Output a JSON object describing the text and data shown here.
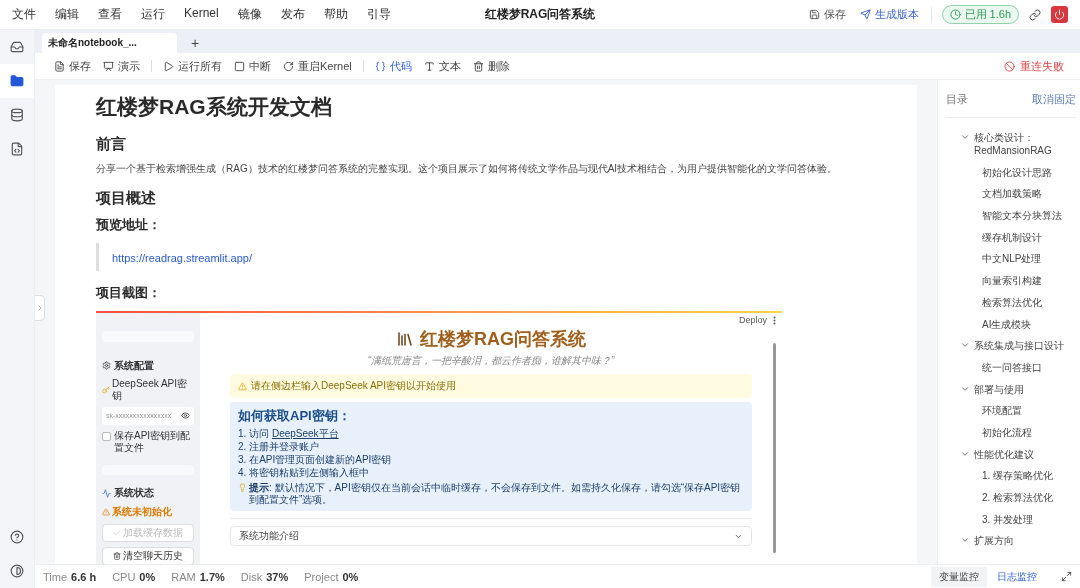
{
  "menu": [
    "文件",
    "编辑",
    "查看",
    "运行",
    "Kernel",
    "镜像",
    "发布",
    "帮助",
    "引导"
  ],
  "title": "红楼梦RAG问答系统",
  "header_actions": [
    {
      "label": "保存",
      "kind": "save"
    },
    {
      "label": "生成版本",
      "kind": "publish"
    }
  ],
  "usage": "已用 1.6h",
  "rail": [
    {
      "kind": "inbox",
      "selected": false
    },
    {
      "kind": "folder",
      "selected": true
    },
    {
      "kind": "database",
      "selected": false
    },
    {
      "kind": "code",
      "selected": false
    }
  ],
  "rail_bottom": [
    {
      "kind": "help"
    },
    {
      "kind": "theme"
    }
  ],
  "tabs": [
    {
      "label": "未命名notebook_...",
      "selected": true
    }
  ],
  "new_tab": "+",
  "toolbar": {
    "groups": [
      [
        {
          "label": "保存",
          "kind": "save",
          "selected": false
        },
        {
          "label": "演示",
          "kind": "present",
          "selected": false
        }
      ],
      [
        {
          "label": "运行所有",
          "kind": "run",
          "selected": false
        },
        {
          "label": "中断",
          "kind": "stop",
          "selected": false
        },
        {
          "label": "重启Kernel",
          "kind": "restart",
          "selected": false
        }
      ],
      [
        {
          "label": "代码",
          "kind": "code",
          "selected": true
        },
        {
          "label": "文本",
          "kind": "text",
          "selected": false
        },
        {
          "label": "删除",
          "kind": "delete",
          "selected": false
        }
      ]
    ]
  },
  "connection": "重连失败",
  "document": {
    "blocks": [
      {
        "kind": "h1",
        "text": "红楼梦RAG系统开发文档"
      },
      {
        "kind": "h2",
        "text": "前言"
      },
      {
        "kind": "p",
        "text": "分享一个基于检索增强生成（RAG）技术的红楼梦问答系统的完整实现。这个项目展示了如何将传统文学作品与现代AI技术相结合，为用户提供智能化的文学问答体验。"
      },
      {
        "kind": "h2",
        "text": "项目概述"
      },
      {
        "kind": "h3",
        "text": "预览地址："
      },
      {
        "kind": "quote_link",
        "text": "https://readrag.streamlit.app/"
      },
      {
        "kind": "h3",
        "text": "项目截图："
      },
      {
        "kind": "app_screenshot",
        "app": {
          "sidebar": {
            "config_title": "系统配置",
            "api_label": "DeepSeek API密钥",
            "api_value": "sk-xxxxxxxxxxxxxxxx",
            "save_option": {
              "label": "保存API密钥到配置文件",
              "checked": false
            },
            "status_title": "系统状态",
            "status_warning": "系统未初始化",
            "buttons": [
              {
                "label": "加载缓存数据",
                "disabled": true
              },
              {
                "label": "清空聊天历史",
                "disabled": false
              }
            ]
          },
          "deploy": "Deploy",
          "title": "红楼梦RAG问答系统",
          "quote": "“满纸荒唐言，一把辛酸泪，都云作者痴，谁解其中味？”",
          "warning": "请在侧边栏输入DeepSeek API密钥以开始使用",
          "info": {
            "title": "如何获取API密钥：",
            "steps": [
              {
                "number": "1.",
                "text": "访问 ",
                "link": "DeepSeek平台"
              },
              {
                "number": "2.",
                "text": "注册并登录账户"
              },
              {
                "number": "3.",
                "text": "在API管理页面创建新的API密钥"
              },
              {
                "number": "4.",
                "text": "将密钥粘贴到左侧输入框中"
              }
            ],
            "tip": "**提示**: 默认情况下，API密钥仅在当前会话中临时缓存，不会保存到文件。如需持久化保存，请勾选“保存API密钥到配置文件”选项。"
          },
          "expander": "系统功能介绍"
        }
      }
    ]
  },
  "toc": {
    "title": "目录",
    "unpin": "取消固定",
    "items": [
      {
        "label": "核心类设计：RedMansionRAG",
        "expanded": true,
        "children": [
          {
            "label": "初始化设计思路"
          },
          {
            "label": "文档加载策略"
          },
          {
            "label": "智能文本分块算法"
          },
          {
            "label": "缓存机制设计"
          },
          {
            "label": "中文NLP处理"
          },
          {
            "label": "向量索引构建"
          },
          {
            "label": "检索算法优化"
          },
          {
            "label": "AI生成模块"
          }
        ]
      },
      {
        "label": "系统集成与接口设计",
        "expanded": true,
        "children": [
          {
            "label": "统一问答接口"
          }
        ]
      },
      {
        "label": "部署与使用",
        "expanded": true,
        "children": [
          {
            "label": "环境配置"
          },
          {
            "label": "初始化流程"
          }
        ]
      },
      {
        "label": "性能优化建议",
        "expanded": true,
        "children": [
          {
            "label": "1. 缓存策略优化"
          },
          {
            "label": "2. 检索算法优化"
          },
          {
            "label": "3. 并发处理"
          }
        ]
      },
      {
        "label": "扩展方向",
        "expanded": true
      }
    ]
  },
  "status": {
    "metrics": [
      {
        "label": "Time",
        "value": "6.6 h"
      },
      {
        "label": "CPU",
        "value": "0%"
      },
      {
        "label": "RAM",
        "value": "1.7%"
      },
      {
        "label": "Disk",
        "value": "37%"
      },
      {
        "label": "Project",
        "value": "0%"
      }
    ],
    "tabs": [
      {
        "label": "变量监控",
        "selected": false
      },
      {
        "label": "日志监控",
        "selected": true
      }
    ]
  }
}
